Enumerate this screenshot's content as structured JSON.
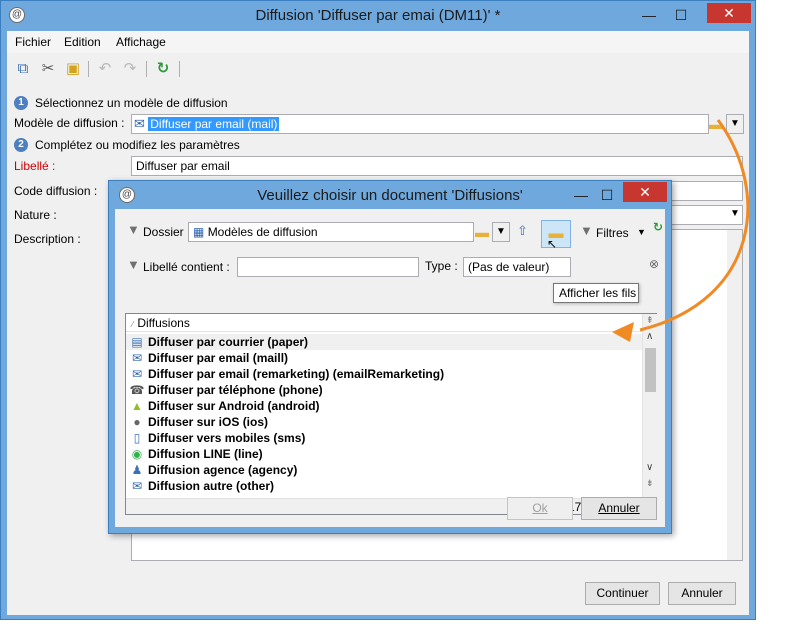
{
  "main": {
    "title": "Diffusion 'Diffuser par emai (DM11)' *",
    "logo": "@",
    "menu": [
      "Fichier",
      "Edition",
      "Affichage"
    ],
    "toolbar_icons": [
      "copy-icon",
      "cut-icon",
      "paste-icon",
      "undo-icon",
      "redo-icon",
      "refresh-icon"
    ],
    "step1": {
      "num": "1",
      "text": "Sélectionnez un modèle de diffusion"
    },
    "model_label": "Modèle de diffusion :",
    "model_value": "Diffuser par email (mail)",
    "step2": {
      "num": "2",
      "text": "Complétez ou modifiez les paramètres"
    },
    "libelle_label": "Libellé :",
    "libelle_value": "Diffuser par email",
    "code_label": "Code diffusion :",
    "nature_label": "Nature :",
    "description_label": "Description :",
    "continue_label": "Continuer",
    "cancel_label": "Annuler",
    "error_color": "#cc0000"
  },
  "dialog": {
    "title": "Veuillez choisir un document 'Diffusions'",
    "folder_label": "Dossier :",
    "folder_value": "Modèles de diffusion",
    "filters_label": "Filtres",
    "libelle_contient_label": "Libellé contient :",
    "libelle_contient_value": "",
    "type_label": "Type :",
    "type_value": "(Pas de valeur)",
    "tooltip": "Afficher les fils",
    "list_header": "Diffusions",
    "items": [
      {
        "icon": "paper-icon",
        "glyph": "▤",
        "label": "Diffuser par courrier (paper)"
      },
      {
        "icon": "email-icon",
        "glyph": "✉",
        "label": "Diffuser par email (maill)"
      },
      {
        "icon": "email-icon",
        "glyph": "✉",
        "label": "Diffuser par email (remarketing) (emailRemarketing)"
      },
      {
        "icon": "phone-icon",
        "glyph": "☎",
        "label": "Diffuser par téléphone (phone)"
      },
      {
        "icon": "android-icon",
        "glyph": "▲",
        "label": "Diffuser sur Android (android)"
      },
      {
        "icon": "apple-icon",
        "glyph": "●",
        "label": "Diffuser sur iOS (ios)"
      },
      {
        "icon": "mobile-icon",
        "glyph": "▯",
        "label": "Diffuser vers mobiles (sms)"
      },
      {
        "icon": "line-icon",
        "glyph": "◉",
        "label": "Diffusion LINE (line)"
      },
      {
        "icon": "agency-icon",
        "glyph": "♟",
        "label": "Diffusion agence (agency)"
      },
      {
        "icon": "email-icon",
        "glyph": "✉",
        "label": "Diffusion autre (other)"
      }
    ],
    "count": "17 / 17",
    "ok_label": "Ok",
    "cancel_label": "Annuler"
  }
}
